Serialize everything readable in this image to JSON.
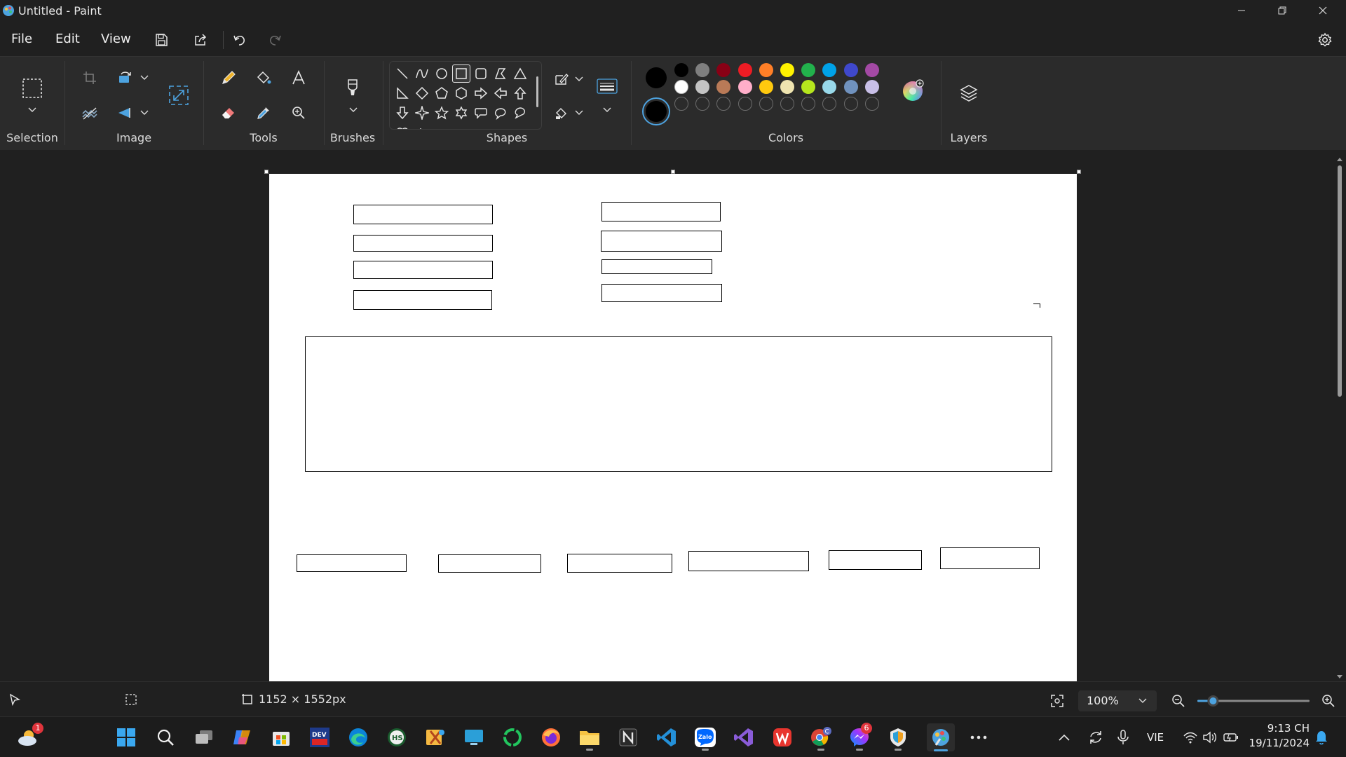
{
  "window": {
    "title": "Untitled - Paint"
  },
  "menu": {
    "file": "File",
    "edit": "Edit",
    "view": "View"
  },
  "ribbon": {
    "groups": {
      "selection": "Selection",
      "image": "Image",
      "tools": "Tools",
      "brushes": "Brushes",
      "shapes": "Shapes",
      "colors": "Colors",
      "layers": "Layers"
    },
    "primary_color": "#000000",
    "secondary_color": "#000000",
    "palette_row1": [
      "#000000",
      "#7f7f7f",
      "#880015",
      "#ed1c24",
      "#ff7f27",
      "#fff200",
      "#22b14c",
      "#00a2e8",
      "#3f48cc",
      "#a349a4"
    ],
    "palette_row2": [
      "#ffffff",
      "#c3c3c3",
      "#b97a57",
      "#ffaec9",
      "#ffc90e",
      "#efe4b0",
      "#b5e61d",
      "#99d9ea",
      "#7092be",
      "#c8bfe7"
    ]
  },
  "status": {
    "canvas_size": "1152 × 1552px",
    "zoom": "100%",
    "zoom_level_fraction": 0.1
  },
  "taskbar": {
    "weather_badge": "1",
    "messenger_badge": "6",
    "chrome_profile": "C",
    "language": "VIE",
    "time": "9:13 CH",
    "date": "19/11/2024"
  },
  "icon_labels": {
    "hs": "HS",
    "dev": "DEV",
    "zalo": "Zalo"
  }
}
